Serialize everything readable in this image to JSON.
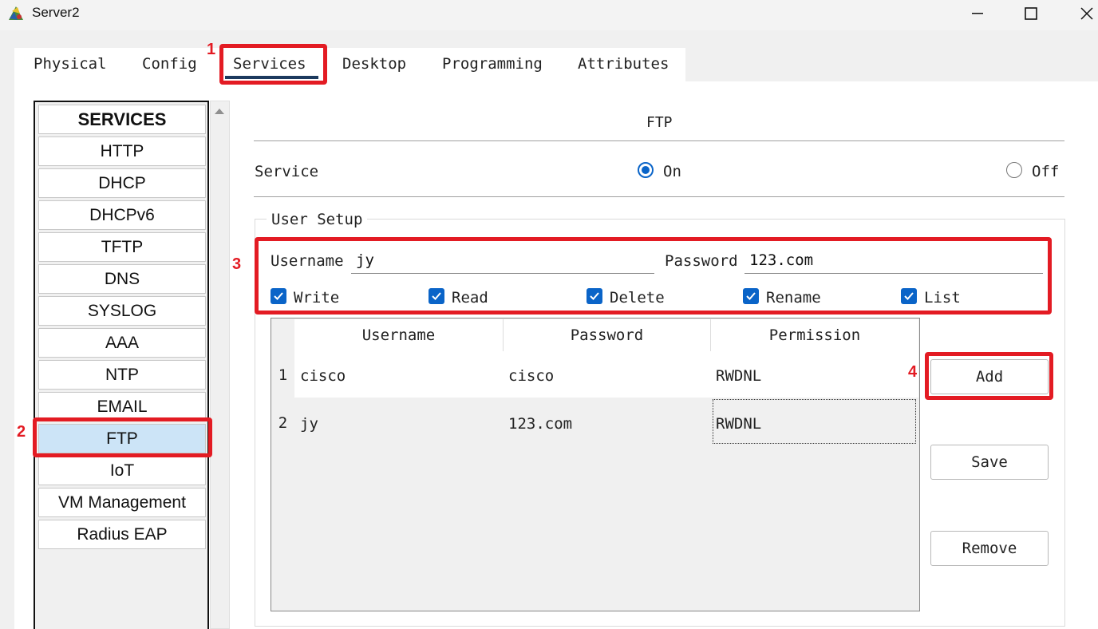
{
  "window": {
    "title": "Server2"
  },
  "tabs": [
    "Physical",
    "Config",
    "Services",
    "Desktop",
    "Programming",
    "Attributes"
  ],
  "sidebar": {
    "header": "SERVICES",
    "items": [
      "HTTP",
      "DHCP",
      "DHCPv6",
      "TFTP",
      "DNS",
      "SYSLOG",
      "AAA",
      "NTP",
      "EMAIL",
      "FTP",
      "IoT",
      "VM Management",
      "Radius EAP"
    ],
    "active": "FTP"
  },
  "content": {
    "title": "FTP",
    "service_label": "Service",
    "on_label": "On",
    "off_label": "Off",
    "service_state": "On"
  },
  "user_setup": {
    "legend": "User Setup",
    "username_label": "Username",
    "username_value": "jy",
    "password_label": "Password",
    "password_value": "123.com",
    "permissions": [
      {
        "label": "Write",
        "checked": true
      },
      {
        "label": "Read",
        "checked": true
      },
      {
        "label": "Delete",
        "checked": true
      },
      {
        "label": "Rename",
        "checked": true
      },
      {
        "label": "List",
        "checked": true
      }
    ]
  },
  "table": {
    "columns": [
      "Username",
      "Password",
      "Permission"
    ],
    "rows": [
      {
        "num": "1",
        "username": "cisco",
        "password": "cisco",
        "permission": "RWDNL"
      },
      {
        "num": "2",
        "username": "jy",
        "password": "123.com",
        "permission": "RWDNL"
      }
    ]
  },
  "buttons": {
    "add": "Add",
    "save": "Save",
    "remove": "Remove"
  },
  "annotations": [
    "1",
    "2",
    "3",
    "4"
  ],
  "colors": {
    "annotation": "#e31b23",
    "accent": "#0a64c8",
    "selected": "#cce4f7",
    "tab_underline": "#1c3a5e"
  }
}
